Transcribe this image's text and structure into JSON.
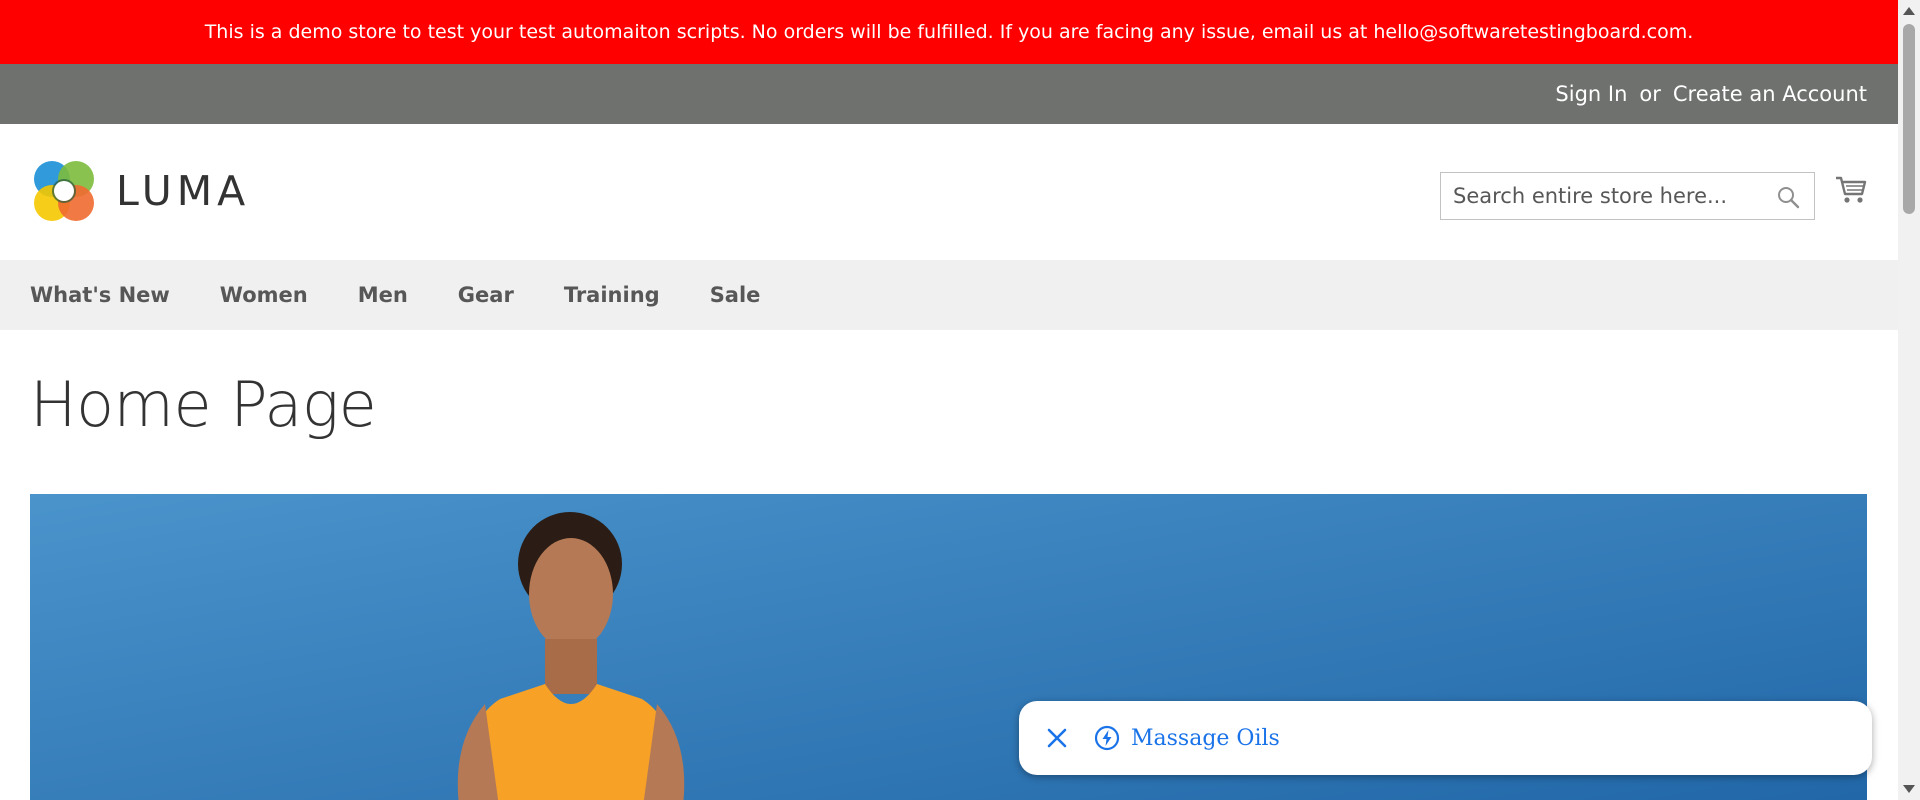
{
  "notice": {
    "text": "This is a demo store to test your test automaiton scripts. No orders will be fulfilled. If you are facing any issue, email us at hello@softwaretestingboard.com."
  },
  "top_links": {
    "sign_in": "Sign In",
    "or": "or",
    "create_account": "Create an Account"
  },
  "header": {
    "logo_text": "LUMA",
    "search_placeholder": "Search entire store here..."
  },
  "nav": {
    "items": [
      "What's New",
      "Women",
      "Men",
      "Gear",
      "Training",
      "Sale"
    ]
  },
  "main": {
    "title": "Home Page"
  },
  "popup": {
    "label": "Massage Oils"
  },
  "colors": {
    "notice_bg": "#ff0000",
    "panel_bg": "#6e716e",
    "nav_bg": "#f0f0f0",
    "hero_sky": "#2f7bb8",
    "popup_link": "#1a73e8"
  }
}
